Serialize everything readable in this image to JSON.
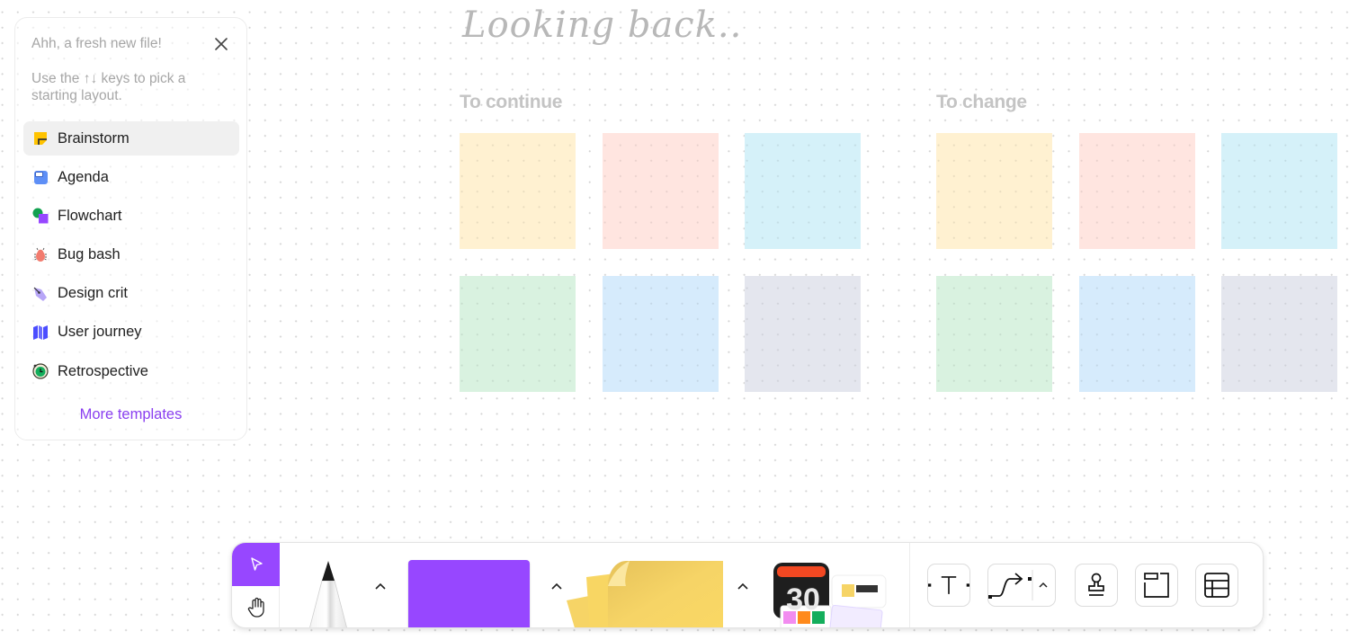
{
  "panel": {
    "title": "Ahh, a fresh new file!",
    "hint": "Use the ↑↓ keys to pick a starting layout.",
    "close_icon": "close-icon",
    "templates": [
      {
        "label": "Brainstorm",
        "icon": "sticky-note-icon",
        "selected": true
      },
      {
        "label": "Agenda",
        "icon": "agenda-icon",
        "selected": false
      },
      {
        "label": "Flowchart",
        "icon": "flowchart-shapes-icon",
        "selected": false
      },
      {
        "label": "Bug bash",
        "icon": "bug-icon",
        "selected": false
      },
      {
        "label": "Design crit",
        "icon": "pen-nib-icon",
        "selected": false
      },
      {
        "label": "User journey",
        "icon": "map-icon",
        "selected": false
      },
      {
        "label": "Retrospective",
        "icon": "stopwatch-icon",
        "selected": false
      }
    ],
    "more_link": "More templates"
  },
  "canvas": {
    "title": "Looking back..",
    "sections": [
      {
        "title": "To continue",
        "stickies": [
          "#fff1d1",
          "#ffe5e0",
          "#d5f1f9",
          "#d9f2e0",
          "#d6ebfc",
          "#e4e6ee"
        ]
      },
      {
        "title": "To change",
        "stickies": [
          "#fff1d1",
          "#ffe5e0",
          "#d5f1f9",
          "#d9f2e0",
          "#d6ebfc",
          "#e4e6ee"
        ]
      }
    ]
  },
  "toolbar": {
    "accent": "#9747ff",
    "modes": [
      {
        "name": "select",
        "icon": "cursor-arrow-icon",
        "active": true
      },
      {
        "name": "hand",
        "icon": "hand-icon",
        "active": false
      }
    ],
    "tools": [
      {
        "name": "pencil",
        "icon": "pencil-icon"
      },
      {
        "name": "shape",
        "icon": "shape-rectangle-icon",
        "color": "#9747ff"
      },
      {
        "name": "sticky",
        "icon": "sticky-stack-icon",
        "color": "#f9d45f"
      },
      {
        "name": "stamps-widgets",
        "icon": "calendar-widgets-icon",
        "calendar_day": "30"
      }
    ],
    "icon_tools": [
      {
        "name": "text",
        "icon": "text-icon"
      },
      {
        "name": "connector",
        "icon": "connector-icon"
      },
      {
        "name": "stamp",
        "icon": "stamp-icon"
      },
      {
        "name": "section",
        "icon": "section-icon"
      },
      {
        "name": "table",
        "icon": "table-icon"
      }
    ]
  }
}
